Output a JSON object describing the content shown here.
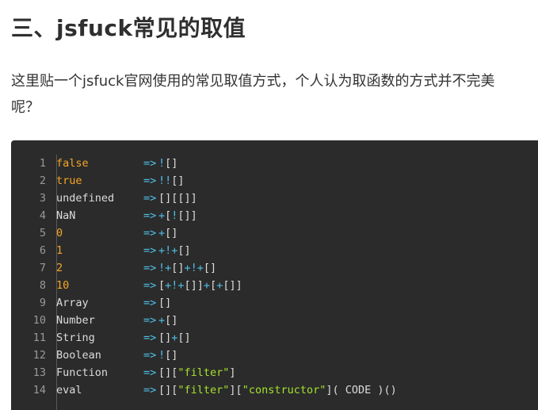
{
  "heading": "三、jsfuck常见的取值",
  "paragraph": {
    "line1": "这里贴一个jsfuck官网使用的常见取值方式，个人认为取函数的方式并不完美",
    "line2": "呢？"
  },
  "code": {
    "arrow": "=>",
    "rows": [
      {
        "num": "1",
        "key": "false",
        "kt": "kw",
        "expr": [
          [
            "op",
            "!"
          ],
          [
            "br",
            "[]"
          ]
        ]
      },
      {
        "num": "2",
        "key": "true",
        "kt": "kw",
        "expr": [
          [
            "op",
            "!!"
          ],
          [
            "br",
            "[]"
          ]
        ]
      },
      {
        "num": "3",
        "key": "undefined",
        "kt": "id",
        "expr": [
          [
            "br",
            "[][[]]"
          ]
        ]
      },
      {
        "num": "4",
        "key": "NaN",
        "kt": "id",
        "expr": [
          [
            "op",
            "+"
          ],
          [
            "br",
            "["
          ],
          [
            "op",
            "!"
          ],
          [
            "br",
            "[]]"
          ]
        ]
      },
      {
        "num": "5",
        "key": "0",
        "kt": "num",
        "expr": [
          [
            "op",
            "+"
          ],
          [
            "br",
            "[]"
          ]
        ]
      },
      {
        "num": "6",
        "key": "1",
        "kt": "num",
        "expr": [
          [
            "op",
            "+!+"
          ],
          [
            "br",
            "[]"
          ]
        ]
      },
      {
        "num": "7",
        "key": "2",
        "kt": "num",
        "expr": [
          [
            "op",
            "!+"
          ],
          [
            "br",
            "[]"
          ],
          [
            "op",
            "+!+"
          ],
          [
            "br",
            "[]"
          ]
        ]
      },
      {
        "num": "8",
        "key": "10",
        "kt": "num",
        "expr": [
          [
            "br",
            "["
          ],
          [
            "op",
            "+!+"
          ],
          [
            "br",
            "[]]"
          ],
          [
            "op",
            "+"
          ],
          [
            "br",
            "["
          ],
          [
            "op",
            "+"
          ],
          [
            "br",
            "[]]"
          ]
        ]
      },
      {
        "num": "9",
        "key": "Array",
        "kt": "id",
        "expr": [
          [
            "br",
            "[]"
          ]
        ]
      },
      {
        "num": "10",
        "key": "Number",
        "kt": "id",
        "expr": [
          [
            "op",
            "+"
          ],
          [
            "br",
            "[]"
          ]
        ]
      },
      {
        "num": "11",
        "key": "String",
        "kt": "id",
        "expr": [
          [
            "br",
            "[]"
          ],
          [
            "op",
            "+"
          ],
          [
            "br",
            "[]"
          ]
        ]
      },
      {
        "num": "12",
        "key": "Boolean",
        "kt": "id",
        "expr": [
          [
            "op",
            "!"
          ],
          [
            "br",
            "[]"
          ]
        ]
      },
      {
        "num": "13",
        "key": "Function",
        "kt": "id",
        "expr": [
          [
            "br",
            "[]["
          ],
          [
            "str",
            "\"filter\""
          ],
          [
            "br",
            "]"
          ]
        ]
      },
      {
        "num": "14",
        "key": "eval",
        "kt": "id",
        "expr": [
          [
            "br",
            "[]["
          ],
          [
            "str",
            "\"filter\""
          ],
          [
            "br",
            "]["
          ],
          [
            "str",
            "\"constructor\""
          ],
          [
            "br",
            "]( CODE )()"
          ]
        ]
      }
    ]
  },
  "colors": {
    "code_bg": "#2b2b2b",
    "keyword": "#f5a623",
    "operator": "#4fc1e9",
    "string": "#a6e22e",
    "plain": "#dcdcdc",
    "gutter": "#999999"
  }
}
